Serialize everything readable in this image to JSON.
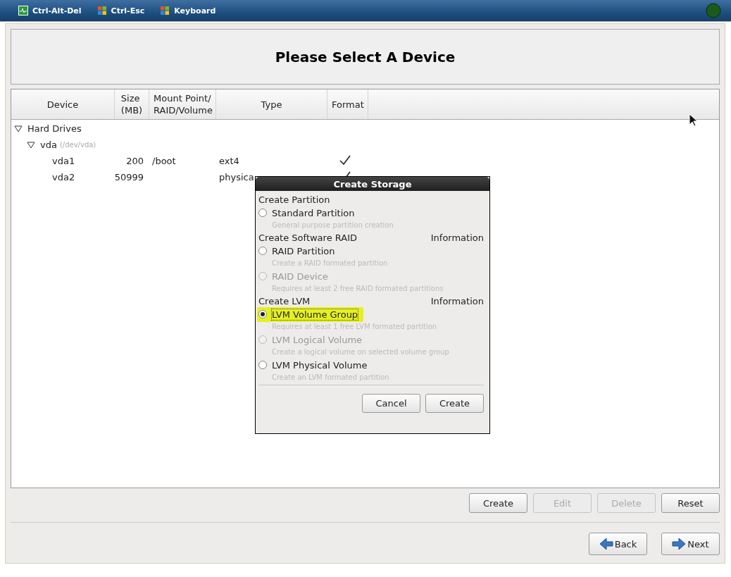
{
  "toolbar": {
    "buttons": [
      {
        "label": "Ctrl-Alt-Del",
        "kind": "monitor"
      },
      {
        "label": "Ctrl-Esc",
        "kind": "windows"
      },
      {
        "label": "Keyboard",
        "kind": "windows"
      }
    ]
  },
  "header": {
    "title": "Please Select A Device"
  },
  "table": {
    "columns": [
      "Device",
      "Size\n(MB)",
      "Mount Point/\nRAID/Volume",
      "Type",
      "Format"
    ],
    "tree": [
      {
        "label": "Hard Drives",
        "expanded": true,
        "children": [
          {
            "label": "vda",
            "detail": "(/dev/vda)",
            "expanded": true,
            "partitions": [
              {
                "device": "vda1",
                "size": "200",
                "mount": "/boot",
                "type": "ext4",
                "format": true
              },
              {
                "device": "vda2",
                "size": "50999",
                "type": "physica",
                "format": true
              }
            ]
          }
        ]
      }
    ]
  },
  "actions": [
    {
      "label": "Create",
      "disabled": false
    },
    {
      "label": "Edit",
      "disabled": true
    },
    {
      "label": "Delete",
      "disabled": true
    },
    {
      "label": "Reset",
      "disabled": false
    }
  ],
  "nav": [
    {
      "label": "Back",
      "kind": "back"
    },
    {
      "label": "Next",
      "kind": "next"
    }
  ],
  "dialog": {
    "title": "Create Storage",
    "sections": [
      {
        "heading": "Create Partition",
        "options": [
          {
            "label": "Standard Partition",
            "description": "General purpose partition creation",
            "selected": false,
            "disabled": false,
            "highlighted": false
          }
        ]
      },
      {
        "heading": "Create Software RAID",
        "info": "Information",
        "options": [
          {
            "label": "RAID Partition",
            "description": "Create a RAID formated partition",
            "selected": false,
            "disabled": false,
            "highlighted": false
          },
          {
            "label": "RAID Device",
            "description": "Requires at least 2 free RAID formated partitions",
            "selected": false,
            "disabled": true,
            "highlighted": false
          }
        ]
      },
      {
        "heading": "Create LVM",
        "info": "Information",
        "options": [
          {
            "label": "LVM Volume Group",
            "description": "Requires at least 1 free LVM formated partition",
            "selected": true,
            "disabled": false,
            "highlighted": true
          },
          {
            "label": "LVM Logical Volume",
            "description": "Create a logical volume on selected volume group",
            "selected": false,
            "disabled": true,
            "highlighted": false
          },
          {
            "label": "LVM Physical Volume",
            "description": "Create an LVM formated partition",
            "selected": false,
            "disabled": false,
            "highlighted": false
          }
        ]
      }
    ],
    "buttons": [
      "Cancel",
      "Create"
    ]
  }
}
